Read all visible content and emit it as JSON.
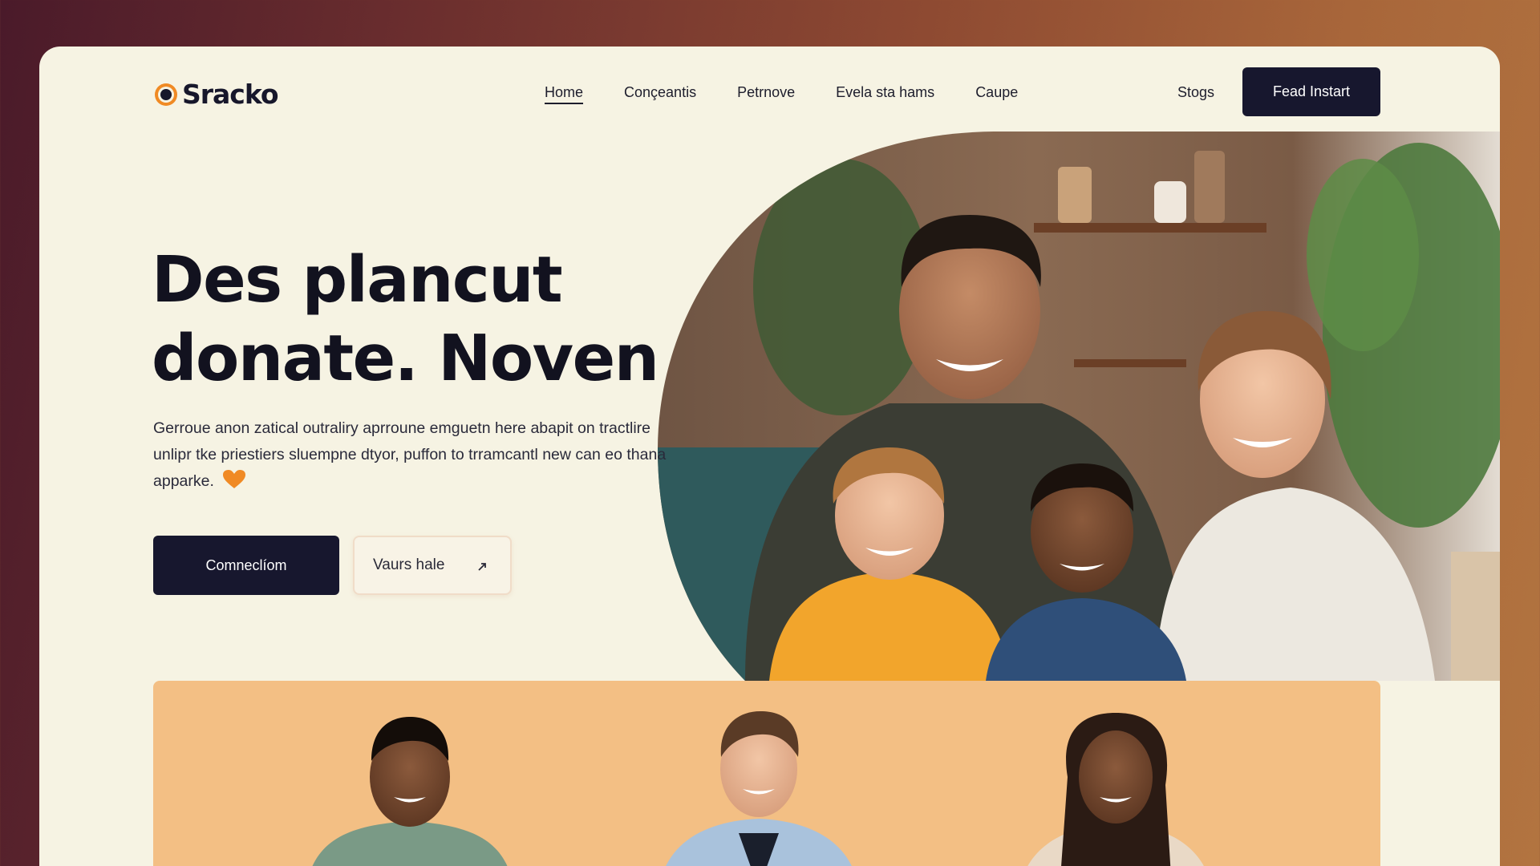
{
  "brand": {
    "name": "Sracko",
    "accent": "#f08a24",
    "dark": "#17172e"
  },
  "nav": {
    "links": [
      {
        "label": "Home",
        "active": true
      },
      {
        "label": "Conçeantis",
        "active": false
      },
      {
        "label": "Petrnove",
        "active": false
      },
      {
        "label": "Evela sta hams",
        "active": false
      },
      {
        "label": "Caupe",
        "active": false
      }
    ],
    "stops_label": "Stogs",
    "cta_label": "Fead Instart"
  },
  "hero": {
    "title_line1": "Des plancut",
    "title_line2": "donate. Noven",
    "description": "Gerroue anon zatical outraliry aprroune emguetn here abapit on tractlire unlipr tke priestiers sluempne dtyor, puffon to trramcantl new can eo thana apparke.",
    "heart_icon": "orange-heart-icon",
    "primary_button": "Comneclíom",
    "secondary_button": "Vaurs hale",
    "secondary_icon": "arrow-icon"
  },
  "colors": {
    "page_bg": "#f6f3e3",
    "team_band": "#f3bf84"
  }
}
